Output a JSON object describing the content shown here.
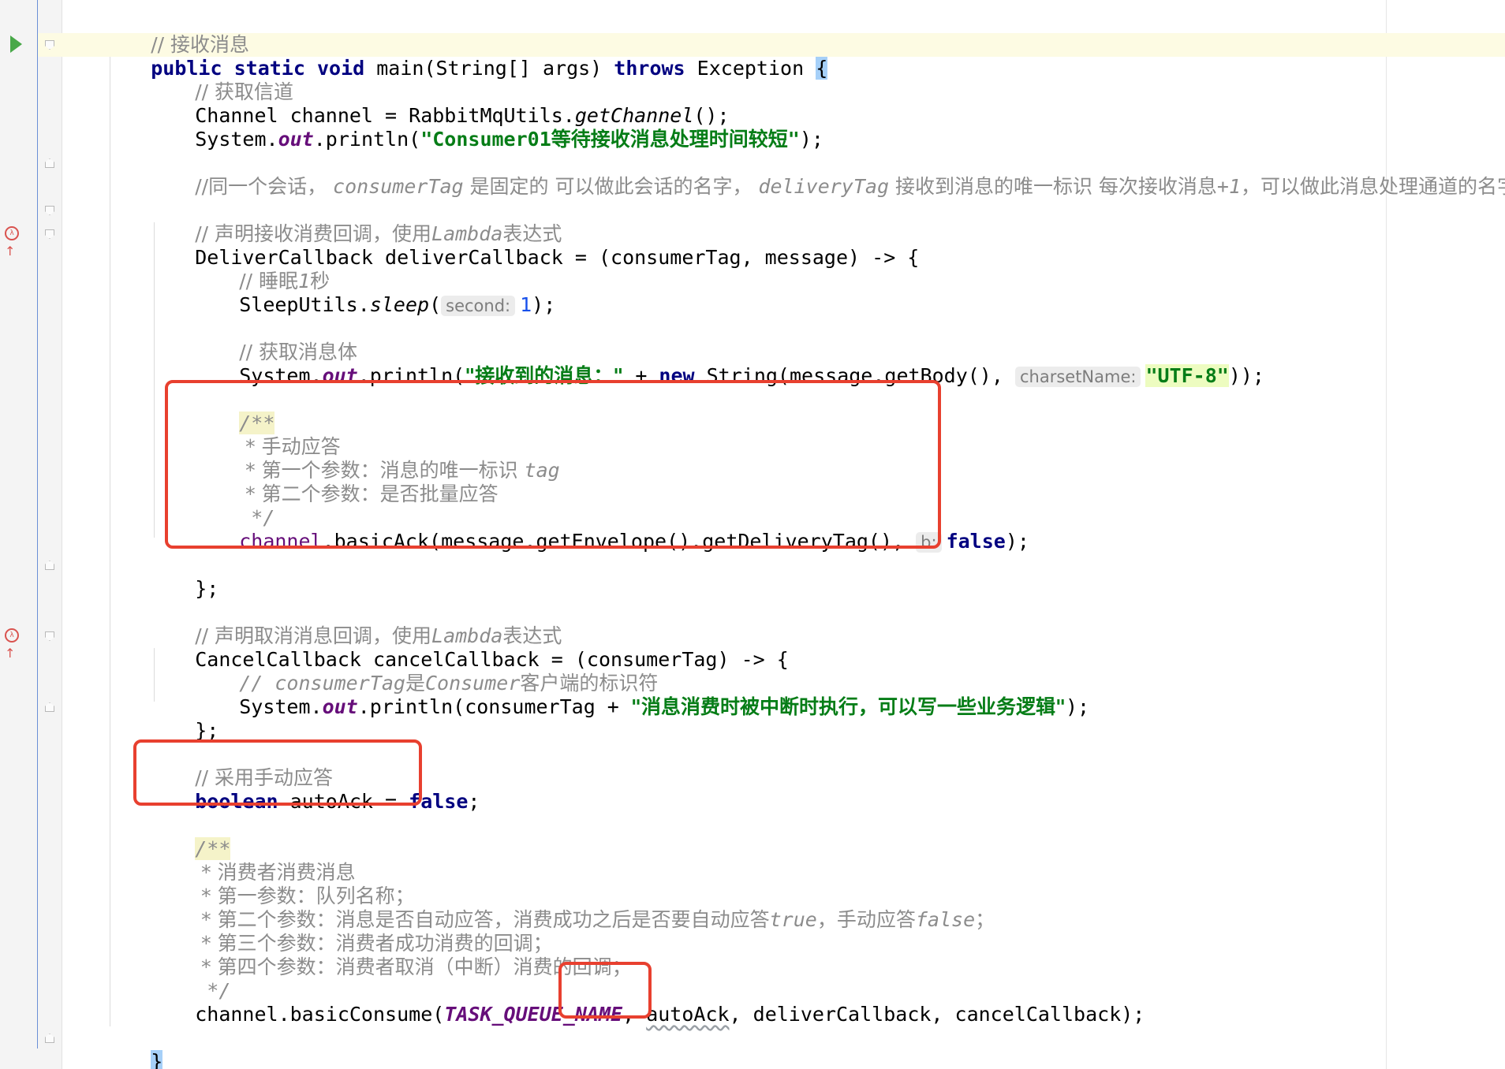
{
  "code": {
    "l1": "// 接收消息",
    "l2": {
      "kw1": "public",
      "kw2": "static",
      "kw3": "void",
      "sig": "main(String[] args)",
      "kw4": "throws",
      "exc": "Exception",
      "brace": "{"
    },
    "l3": "// 获取信道",
    "l4": {
      "a": "Channel channel = RabbitMqUtils.",
      "b": "getChannel",
      "c": "();"
    },
    "l5": {
      "a": "System.",
      "b": "out",
      "c": ".println(",
      "d": "\"Consumer01等待接收消息处理时间较短\"",
      "e": ");"
    },
    "l6": {
      "a": "//同一个会话， ",
      "b": "consumerTag",
      "c": " 是固定的 可以做此会话的名字， ",
      "d": "deliveryTag",
      "e": " 接收到消息的唯一标识 每次接收消息",
      "f": "+1",
      "g": "，可以做此消息处理通道的名字。"
    },
    "l7": {
      "a": "// 声明接收消费回调，使用",
      "b": "Lambda",
      "c": "表达式"
    },
    "l8": "DeliverCallback deliverCallback = (consumerTag, message) -> {",
    "l9": {
      "a": "// 睡眠",
      "b": "1",
      "c": "秒"
    },
    "l10": {
      "a": "SleepUtils.",
      "b": "sleep",
      "c": "(",
      "hint": "second:",
      "d": "1",
      "e": ");"
    },
    "l11": "// 获取消息体",
    "l12": {
      "a": "System.",
      "b": "out",
      "c": ".println(",
      "d": "\"接收到的消息：\"",
      "e": " + ",
      "f": "new",
      "g": " String(message.getBody(), ",
      "hint": "charsetName:",
      "h": "\"UTF-8\"",
      "i": "));"
    },
    "l13": "/**",
    "l14": " * 手动应答",
    "l15": {
      "a": " * 第一个参数：消息的唯一标识 ",
      "b": "tag"
    },
    "l16": " * 第二个参数：是否批量应答",
    "l17": " */",
    "l18": {
      "a": "channel",
      "b": ".basicAck(message.getEnvelope().getDeliveryTag(), ",
      "hint": "b:",
      "c": "false",
      "d": ");"
    },
    "l19": "};",
    "l20": {
      "a": "// 声明取消消息回调，使用",
      "b": "Lambda",
      "c": "表达式"
    },
    "l21": "CancelCallback cancelCallback = (consumerTag) -> {",
    "l22": {
      "a": "// ",
      "b": "consumerTag",
      "c": "是",
      "d": "Consumer",
      "e": "客户端的标识符"
    },
    "l23": {
      "a": "System.",
      "b": "out",
      "c": ".println(consumerTag + ",
      "d": "\"消息消费时被中断时执行，可以写一些业务逻辑\"",
      "e": ");"
    },
    "l24": "};",
    "l25": "// 采用手动应答",
    "l26": {
      "a": "boolean",
      "b": " autoAck = ",
      "c": "false",
      "d": ";"
    },
    "l27": "/**",
    "l28": " * 消费者消费消息",
    "l29": " * 第一参数：队列名称；",
    "l30": {
      "a": " * 第二个参数：消息是否自动应答，消费成功之后是否要自动应答",
      "b": "true",
      "c": "，手动应答",
      "d": "false",
      "e": "；"
    },
    "l31": " * 第三个参数：消费者成功消费的回调；",
    "l32": " * 第四个参数：消费者取消（中断）消费的回调；",
    "l33": " */",
    "l34": {
      "a": "channel.basicConsume(",
      "b": "TASK_QUEUE_NAME",
      "c": ", ",
      "d": "autoAck",
      "e": ", deliverCallback, cancelCallback);"
    },
    "l35": "}",
    "l36": "}"
  },
  "gutter": {
    "run_icon": "run-icon",
    "lambda_icon": "lambda-override-icon",
    "fold_icon": "fold-icon"
  },
  "highlight_color": "#e8402f"
}
